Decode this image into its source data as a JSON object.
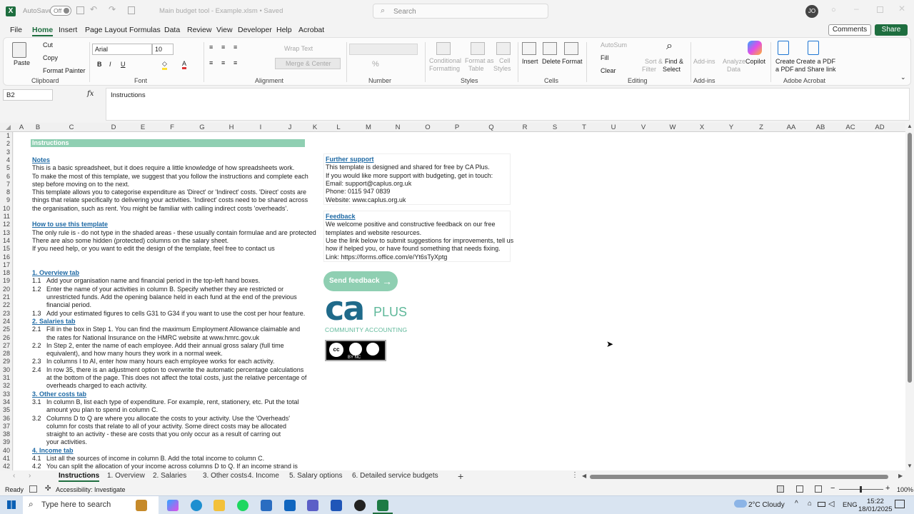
{
  "titlebar": {
    "autosave_label": "AutoSave",
    "autosave_state": "Off",
    "doc_title": "Main budget tool - Example.xlsm  •  Saved",
    "search_placeholder": "Search",
    "avatar_initials": "JO"
  },
  "menu": {
    "tabs": [
      "File",
      "Home",
      "Insert",
      "Page Layout",
      "Formulas",
      "Data",
      "Review",
      "View",
      "Developer",
      "Help",
      "Acrobat"
    ],
    "active_index": 1,
    "comments_label": "Comments",
    "share_label": "Share"
  },
  "ribbon": {
    "clipboard": {
      "paste": "Paste",
      "cut": "Cut",
      "copy": "Copy",
      "format_painter": "Format Painter",
      "label": "Clipboard"
    },
    "font": {
      "name": "Arial",
      "size": "10",
      "label": "Font"
    },
    "alignment": {
      "wrap": "Wrap Text",
      "merge": "Merge & Center",
      "label": "Alignment"
    },
    "number": {
      "label": "Number"
    },
    "styles": {
      "conditional": "Conditional",
      "conditional2": "Formatting",
      "format_table": "Format as",
      "format_table2": "Table",
      "cell_styles": "Cell",
      "cell_styles2": "Styles",
      "label": "Styles"
    },
    "cells": {
      "insert": "Insert",
      "delete": "Delete",
      "format": "Format",
      "label": "Cells"
    },
    "editing": {
      "autosum": "AutoSum",
      "fill": "Fill",
      "clear": "Clear",
      "sort": "Sort &",
      "sort2": "Filter",
      "find": "Find &",
      "find2": "Select",
      "label": "Editing"
    },
    "addins": {
      "analyze": "Analyze",
      "analyze2": "Data",
      "addins": "Add-ins",
      "copilot": "Copilot",
      "label": "Add-ins"
    },
    "acrobat": {
      "create_pdf": "Create",
      "create_pdf2": "a PDF",
      "create_share": "Create a PDF",
      "create_share2": "and Share link",
      "label": "Adobe Acrobat"
    }
  },
  "formula_bar": {
    "name_box": "B2",
    "fx": "fx",
    "value": "Instructions"
  },
  "columns": [
    "A",
    "B",
    "C",
    "D",
    "E",
    "F",
    "G",
    "H",
    "I",
    "J",
    "K",
    "L",
    "M",
    "N",
    "O",
    "P",
    "Q",
    "R",
    "S",
    "T",
    "U",
    "V",
    "W",
    "X",
    "Y",
    "Z",
    "AA",
    "AB",
    "AC",
    "AD"
  ],
  "rows": [
    "1",
    "2",
    "3",
    "4",
    "5",
    "6",
    "7",
    "8",
    "9",
    "10",
    "11",
    "12",
    "13",
    "14",
    "15",
    "16",
    "17",
    "18",
    "19",
    "20",
    "21",
    "22",
    "23",
    "24",
    "25",
    "26",
    "27",
    "28",
    "29",
    "30",
    "31",
    "32",
    "33",
    "34",
    "35",
    "36",
    "37",
    "38",
    "39",
    "40",
    "41",
    "42"
  ],
  "sheet": {
    "banner": "Instructions",
    "notes_heading": "Notes",
    "notes": [
      "This is a basic spreadsheet, but it does require a little knowledge of how spreadsheets work.",
      "To make the most of this template, we suggest that you follow the instructions and complete each",
      "step before moving on to the next.",
      "This template allows you to categorise expenditure as 'Direct' or 'Indirect' costs. 'Direct' costs are",
      "things that relate specifically to delivering your activities. 'Indirect' costs need to be shared across",
      "the organisation, such as rent. You might be familiar with calling indirect costs 'overheads'."
    ],
    "howto_heading": "How to use this template",
    "howto": [
      "The only rule is - do not type in the shaded areas - these usually contain formulae and are protected",
      "There are also some hidden (protected) columns on the salary sheet.",
      "If you need help, or you want to edit the design of the template, feel free to contact us"
    ],
    "overview_heading": "1. Overview tab",
    "overview": [
      [
        "1.1",
        "Add your organisation name and financial period in the top-left hand boxes."
      ],
      [
        "1.2",
        "Enter the name of your activities in column B. Specify whether they are restricted or"
      ],
      [
        "",
        "unrestricted funds. Add the opening balance held in each fund at the end of the previous"
      ],
      [
        "",
        "financial period."
      ],
      [
        "1.3",
        "Add your estimated figures to cells G31 to G34 if you want to use the cost per hour feature."
      ]
    ],
    "salaries_heading": "2. Salaries tab",
    "salaries": [
      [
        "2.1",
        "Fill in the box in Step 1. You can find the maximum Employment Allowance claimable and"
      ],
      [
        "",
        "the rates for National Insurance on the HMRC website at www.hmrc.gov.uk"
      ],
      [
        "2.2",
        "In Step 2, enter the name of each employee. Add their annual gross salary (full time"
      ],
      [
        "",
        "equivalent), and how many hours they work in a normal week."
      ],
      [
        "2.3",
        "In columns I to AI, enter how many hours each employee works for each activity."
      ],
      [
        "2.4",
        "In row 35, there is an adjustment option to overwrite the automatic percentage calculations"
      ],
      [
        "",
        "at the bottom of the page. This does not affect the total costs, just the relative percentage of"
      ],
      [
        "",
        "overheads charged to each activity."
      ]
    ],
    "other_heading": "3. Other costs tab",
    "other": [
      [
        "3.1",
        "In column B, list each type of expenditure. For example, rent, stationery, etc. Put the total"
      ],
      [
        "",
        "amount you plan to spend in column C."
      ],
      [
        "3.2",
        "Columns D to Q are where you allocate the costs to your activity. Use the 'Overheads'"
      ],
      [
        "",
        "column for costs that relate to all of your activity. Some direct costs may be allocated"
      ],
      [
        "",
        "straight to an activity - these are costs that you only occur as a result of carring out"
      ],
      [
        "",
        "your activities."
      ]
    ],
    "income_heading": "4. Income tab",
    "income": [
      [
        "4.1",
        "List all the sources of income in column B. Add the total income to column C."
      ],
      [
        "4.2",
        "You can split the allocation of your income across columns D to Q. If an income strand is"
      ]
    ],
    "support_heading": "Further support",
    "support": [
      "This template is designed and shared for free by CA Plus.",
      "If you would like more support with budgeting, get in touch:",
      "Email: support@caplus.org.uk",
      "Phone: 0115 947 0839",
      "Website: www.caplus.org.uk"
    ],
    "feedback_heading": "Feedback",
    "feedback": [
      "We welcome positive and constructive feedback on our free",
      "templates and website resources.",
      "Use the link below to submit suggestions for improvements, tell us",
      "how if helped you, or have found something that needs fixing.",
      "Link: https://forms.office.com/e/Yt6sTyXptg"
    ],
    "send_feedback": "Send feedback",
    "logo_ca": "ca",
    "logo_plus": "PLUS",
    "logo_tagline": "COMMUNITY ACCOUNTING",
    "cc_label": "BY    NC"
  },
  "sheet_tabs": [
    "Instructions",
    "1. Overview",
    "2. Salaries",
    "3. Other costs",
    "4. Income",
    "5. Salary options",
    "6. Detailed service budgets"
  ],
  "status": {
    "ready": "Ready",
    "accessibility": "Accessibility: Investigate",
    "zoom": "100%"
  },
  "taskbar": {
    "search_placeholder": "Type here to search",
    "weather": "2°C  Cloudy",
    "lang": "ENG",
    "time": "15:22",
    "date": "18/01/2025"
  },
  "colors": {
    "excel_green": "#1e6e3f",
    "banner": "#8fcfb2",
    "link_blue": "#1f6aa5",
    "feedback_button": "#8fcfb2"
  }
}
